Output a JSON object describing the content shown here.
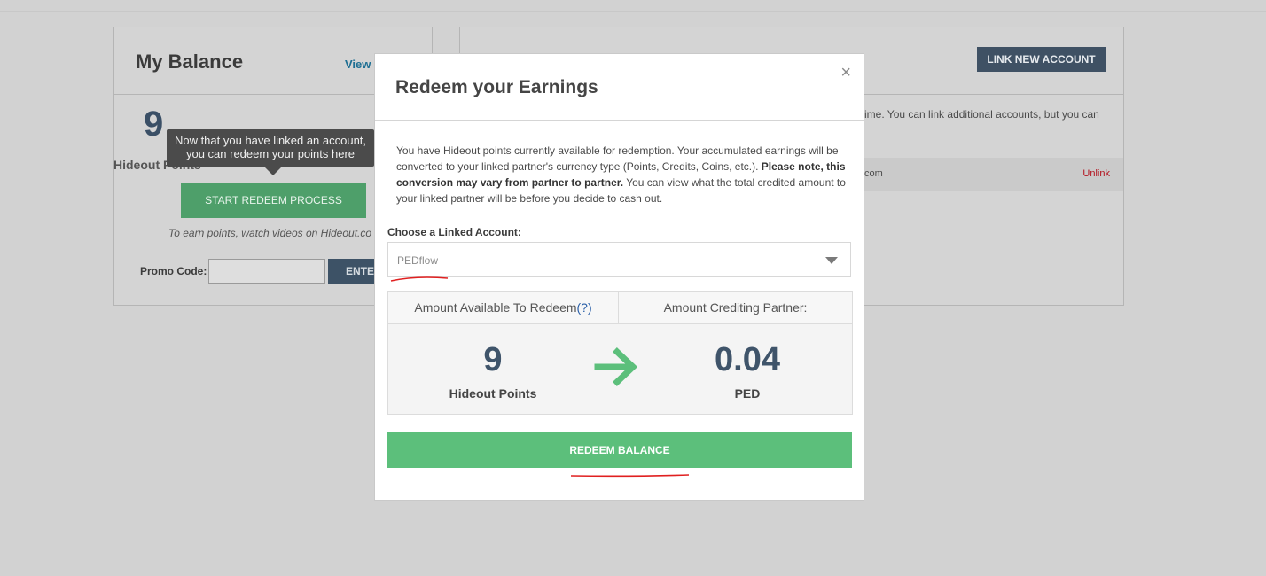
{
  "background": {
    "balance_title": "My Balance",
    "view_link": "View",
    "big_number": "9",
    "hideout_points_label": "Hideout Points",
    "tooltip": "Now that you have linked an account, you can redeem your points here",
    "start_button": "START REDEEM PROCESS",
    "earn_note": "To earn points, watch videos on Hideout.co",
    "promo_label": "Promo Code:",
    "promo_value": "",
    "enter_button": "ENTER",
    "link_new_button": "LINK NEW ACCOUNT",
    "accounts_text": "ime. You can link additional accounts, but you can",
    "account_row_text": "com",
    "unlink_link": "Unlink"
  },
  "modal": {
    "title": "Redeem your Earnings",
    "close_icon": "×",
    "desc_part1": "You have Hideout points currently available for redemption. Your accumulated earnings will be converted to your linked partner's currency type (Points, Credits, Coins, etc.). ",
    "desc_bold": "Please note, this conversion may vary from partner to partner.",
    "desc_part2": " You can view what the total credited amount to your linked partner will be before you decide to cash out.",
    "choose_label": "Choose a Linked Account:",
    "selected_account": "PEDflow",
    "amount_available_header": "Amount Available To Redeem",
    "help_marker": "(?)",
    "amount_crediting_header": "Amount Crediting Partner:",
    "points_value": "9",
    "points_unit": "Hideout Points",
    "credit_value": "0.04",
    "credit_unit": "PED",
    "redeem_button": "REDEEM BALANCE"
  },
  "colors": {
    "green_button": "#5cbf7b",
    "dark_navy": "#3f546a",
    "unlink_red": "#b3101c",
    "annotation_red": "#e02020"
  },
  "icons": {
    "close": "close-icon",
    "caret": "chevron-down-icon",
    "arrow": "arrow-right-icon"
  }
}
